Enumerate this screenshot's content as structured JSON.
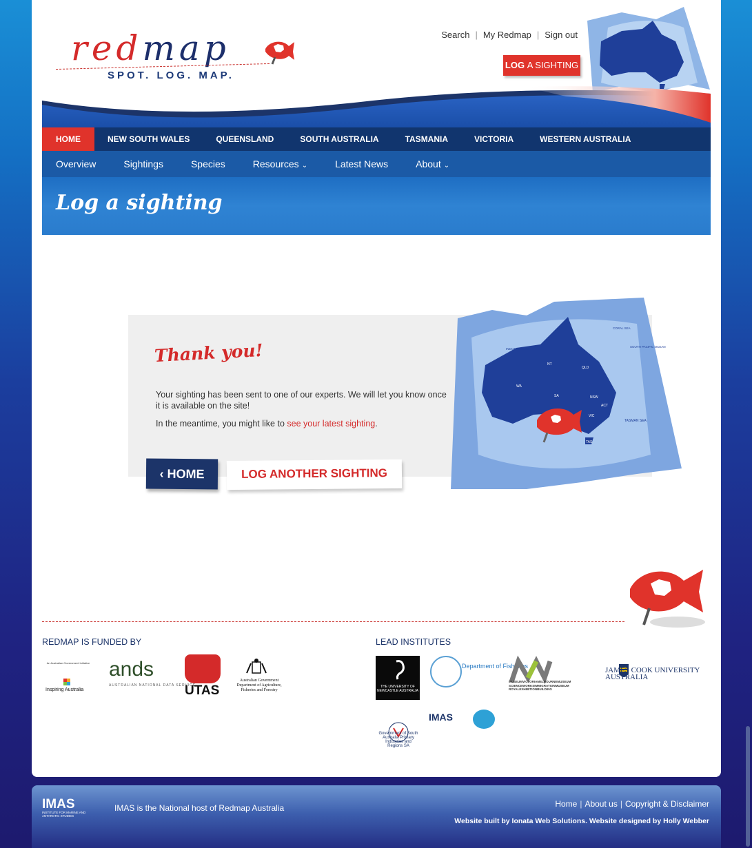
{
  "logo": {
    "word_red": "red",
    "word_blue": "map",
    "tagline": "SPOT. LOG. MAP."
  },
  "util_links": [
    "Search",
    "My Redmap",
    "Sign out"
  ],
  "log_button": {
    "strong": "LOG",
    "rest": "A SIGHTING"
  },
  "nav_primary": [
    "HOME",
    "NEW SOUTH WALES",
    "QUEENSLAND",
    "SOUTH AUSTRALIA",
    "TASMANIA",
    "VICTORIA",
    "WESTERN AUSTRALIA"
  ],
  "nav_secondary": [
    {
      "label": "Overview",
      "chevron": false
    },
    {
      "label": "Sightings",
      "chevron": false
    },
    {
      "label": "Species",
      "chevron": false
    },
    {
      "label": "Resources",
      "chevron": true
    },
    {
      "label": "Latest News",
      "chevron": false
    },
    {
      "label": "About",
      "chevron": true
    }
  ],
  "page_title": "Log a sighting",
  "thank_you": {
    "heading": "Thank you!",
    "line1": "Your sighting has been sent to one of our experts. We will let you know once it is available on the site!",
    "line2_prefix": "In the meantime, you might like to ",
    "line2_link": "see your latest sighting",
    "line2_suffix": "."
  },
  "buttons": {
    "home": "HOME",
    "log_another": "LOG ANOTHER SIGHTING"
  },
  "funded_by": {
    "title": "REDMAP IS FUNDED BY",
    "austgov_text": "An Australian Government Initiative",
    "inspiring_text": "Inspiring Australia",
    "ands": "ands",
    "ands_sub": "AUSTRALIAN NATIONAL DATA SERVICE",
    "utas": "UTAS",
    "gov_dept": "Australian Government Department of Agriculture, Fisheries and Forestry"
  },
  "lead_institutes": {
    "title": "LEAD INSTITUTES",
    "newcastle": "THE UNIVERSITY OF NEWCASTLE AUSTRALIA",
    "fisheries": "Department of Fisheries",
    "museum": "MUSEUMVICTORIAMELBOURNEMUSEUM SCIENCEWORKSIMMIGRATIONMUSEUM ROYALEXHIBITIONBUILDING",
    "jcu": "JAMES COOK UNIVERSITY AUSTRALIA",
    "sa_gov": "Government of South Australia Primary Industries and Regions SA",
    "imas": "IMAS"
  },
  "map_labels": [
    "WA",
    "NT",
    "QLD",
    "SA",
    "NSW",
    "ACT",
    "VIC",
    "TAS",
    "CORAL SEA",
    "SOUTH PACIFIC OCEAN",
    "TASMAN SEA",
    "INDIAN OCEAN"
  ],
  "footer": {
    "imas": "IMAS",
    "imas_sub": "INSTITUTE FOR MARINE AND ANTARCTIC STUDIES",
    "host": "IMAS is the National host of Redmap Australia",
    "links": [
      "Home",
      "About us",
      "Copyright & Disclaimer"
    ],
    "credit": "Website built by Ionata Web Solutions. Website designed by Holly Webber"
  },
  "colors": {
    "accent_red": "#e0332b",
    "navy": "#11356e",
    "nav_blue": "#1b5aa6"
  }
}
